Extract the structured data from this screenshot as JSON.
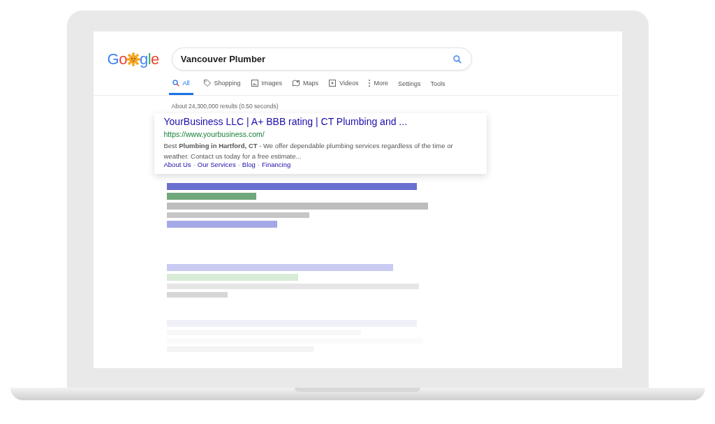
{
  "logo": {
    "text_before": "Go",
    "text_after": "gle"
  },
  "search": {
    "value": "Vancouver Plumber"
  },
  "tabs": [
    {
      "label": "All",
      "kind": "search",
      "selected": true
    },
    {
      "label": "Shopping",
      "kind": "tag",
      "selected": false
    },
    {
      "label": "Images",
      "kind": "image",
      "selected": false
    },
    {
      "label": "Maps",
      "kind": "map",
      "selected": false
    },
    {
      "label": "Videos",
      "kind": "play",
      "selected": false
    },
    {
      "label": "More",
      "kind": "dots",
      "selected": false
    }
  ],
  "tools": [
    "Settings",
    "Tools"
  ],
  "result_stats": "About 24,300,000 results (0.50 seconds)",
  "result": {
    "title": "YourBusiness LLC | A+ BBB rating | CT Plumbing and ...",
    "url": "https://www.yourbusiness.com/",
    "snippet": "Best **Plumbing in Hartford, CT** - We offer dependable plumbing services regardless of the time or weather. Contact us today for a free estimate...",
    "sitelinks": [
      "About Us",
      "Our Services",
      "Blog",
      "Financing"
    ],
    "sitelink_separators": [
      "·",
      "·",
      "·"
    ]
  }
}
